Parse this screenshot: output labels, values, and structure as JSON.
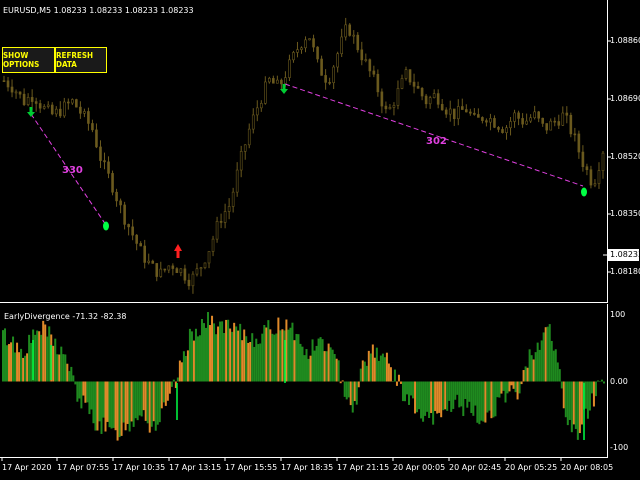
{
  "chart_header": {
    "symbol_info": "EURUSD,M5  1.08233 1.08233 1.08233 1.08233"
  },
  "buttons": {
    "show_options": "SHOW OPTIONS",
    "refresh_data": "REFRESH DATA"
  },
  "indicator": {
    "title": "EarlyDivergence -71.32 -82.38"
  },
  "price_axis": {
    "labels": [
      "1.08860",
      "1.08690",
      "1.08520",
      "1.08350",
      "1.08180"
    ],
    "current_price": "1.08233"
  },
  "indicator_axis": {
    "labels": [
      "100",
      "0.00",
      "-100"
    ]
  },
  "time_axis": {
    "labels": [
      "17 Apr 2020",
      "17 Apr 07:55",
      "17 Apr 10:35",
      "17 Apr 13:15",
      "17 Apr 15:55",
      "17 Apr 18:35",
      "17 Apr 21:15",
      "20 Apr 00:05",
      "20 Apr 02:45",
      "20 Apr 05:25",
      "20 Apr 08:05"
    ]
  },
  "annotations": {
    "divergence_left": "330",
    "divergence_right": "302"
  },
  "colors": {
    "background": "#000000",
    "candles": "#6b5a1e",
    "button_text": "#ffff00",
    "annotation": "#e040e0",
    "bull_hist": "#1f8a1f",
    "bear_hist": "#e08a2a",
    "signal_dot": "#00ff44",
    "down_arrow": "#00cc33",
    "up_arrow": "#ff2020"
  },
  "chart_data": {
    "type": "line",
    "title": "EURUSD,M5  1.08233 1.08233 1.08233 1.08233",
    "ylim": [
      1.0813,
      1.0893
    ],
    "price_series": [
      1.0876,
      1.0874,
      1.087,
      1.0872,
      1.0868,
      1.0866,
      1.0868,
      1.087,
      1.0866,
      1.0862,
      1.0852,
      1.0846,
      1.0838,
      1.0832,
      1.0826,
      1.0822,
      1.082,
      1.0823,
      1.0821,
      1.0818,
      1.0822,
      1.0828,
      1.0836,
      1.084,
      1.0852,
      1.0862,
      1.087,
      1.0876,
      1.0874,
      1.088,
      1.0886,
      1.089,
      1.088,
      1.0876,
      1.0884,
      1.0892,
      1.0886,
      1.088,
      1.0874,
      1.0866,
      1.0872,
      1.0878,
      1.0874,
      1.087,
      1.0872,
      1.0868,
      1.0866,
      1.0868,
      1.0864,
      1.0866,
      1.0864,
      1.0862,
      1.0866,
      1.0864,
      1.0866,
      1.0862,
      1.0864,
      1.0866,
      1.086,
      1.0852,
      1.0846,
      1.0856
    ],
    "indicator": {
      "name": "EarlyDivergence",
      "ylim": [
        -110,
        110
      ],
      "values": [
        70,
        60,
        45,
        60,
        80,
        70,
        50,
        30,
        -20,
        -40,
        -60,
        -70,
        -80,
        -70,
        -60,
        -40,
        -70,
        -55,
        -30,
        10,
        60,
        80,
        90,
        85,
        80,
        75,
        70,
        65,
        70,
        80,
        85,
        90,
        60,
        40,
        60,
        55,
        30,
        -10,
        -40,
        30,
        50,
        40,
        20,
        -10,
        -30,
        -50,
        -60,
        -55,
        -40,
        -30,
        -40,
        -50,
        -60,
        -40,
        -30,
        -20,
        -10,
        40,
        60,
        80,
        30,
        -60,
        -80,
        -50,
        -20,
        10
      ]
    }
  }
}
